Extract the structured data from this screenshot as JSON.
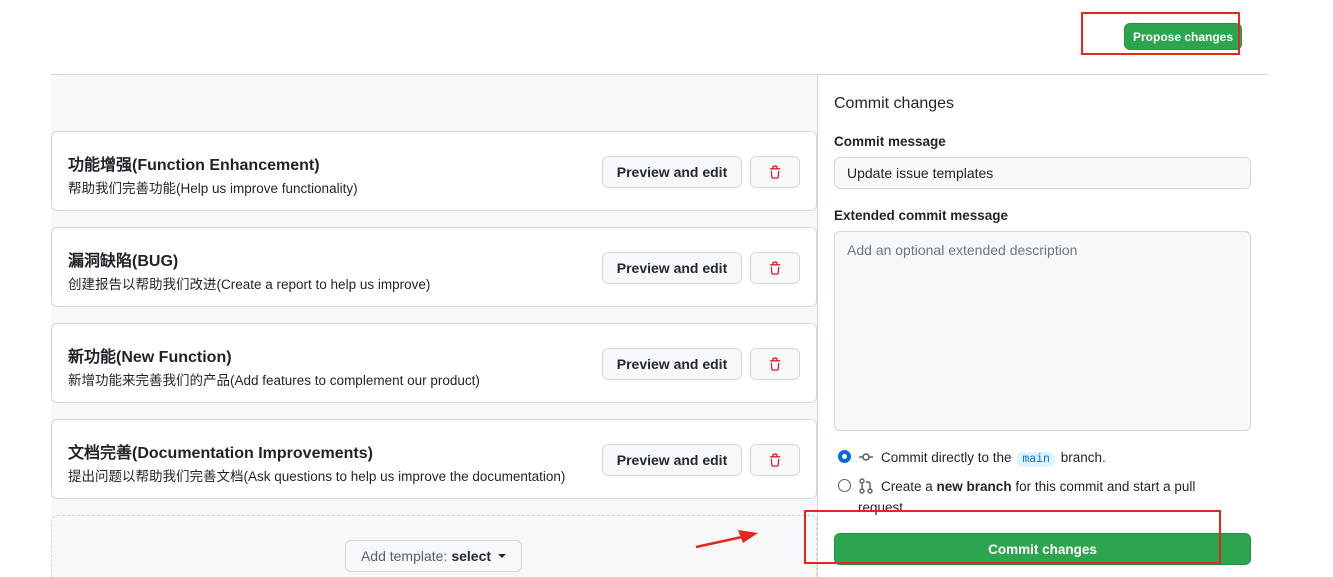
{
  "header": {
    "propose_label": "Propose changes"
  },
  "templates": [
    {
      "title": "功能增强(Function Enhancement)",
      "description": "帮助我们完善功能(Help us improve functionality)",
      "preview_label": "Preview and edit"
    },
    {
      "title": "漏洞缺陷(BUG)",
      "description": "创建报告以帮助我们改进(Create a report to help us improve)",
      "preview_label": "Preview and edit"
    },
    {
      "title": "新功能(New Function)",
      "description": "新增功能来完善我们的产品(Add features to complement our product)",
      "preview_label": "Preview and edit"
    },
    {
      "title": "文档完善(Documentation Improvements)",
      "description": "提出问题以帮助我们完善文档(Ask questions to help us improve the documentation)",
      "preview_label": "Preview and edit"
    }
  ],
  "add_template": {
    "prefix": "Add template:",
    "select_label": "select"
  },
  "commit": {
    "heading": "Commit changes",
    "message_label": "Commit message",
    "message_value": "Update issue templates",
    "extended_label": "Extended commit message",
    "extended_placeholder": "Add an optional extended description",
    "option_direct_prefix": "Commit directly to the",
    "branch_name": "main",
    "option_direct_suffix": "branch.",
    "option_new_prefix": "Create a",
    "option_new_bold": "new branch",
    "option_new_suffix": "for this commit and start a pull",
    "option_new_wrap": "request.",
    "selected_option": "direct",
    "button_label": "Commit changes"
  },
  "icons": {
    "delete": "trash-icon",
    "commit": "git-commit-icon",
    "pull_request": "git-pull-request-icon",
    "annotation": "red-arrow"
  },
  "colors": {
    "primary_green": "#2da44e",
    "danger_red": "#cf222e",
    "annotation_red": "#e5261f",
    "link_blue": "#0969da"
  }
}
